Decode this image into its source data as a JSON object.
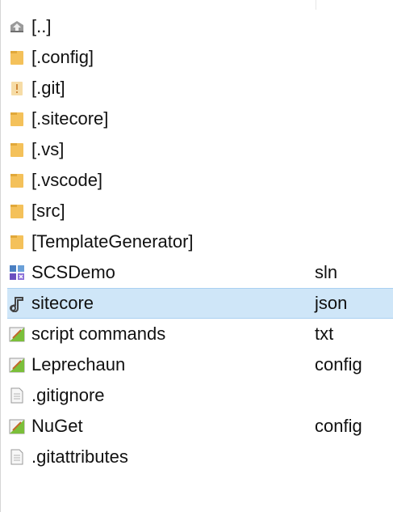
{
  "file_list": {
    "items": [
      {
        "name": "[..]",
        "ext": "",
        "icon": "up-folder-icon"
      },
      {
        "name": "[.config]",
        "ext": "",
        "icon": "folder-icon"
      },
      {
        "name": "[.git]",
        "ext": "",
        "icon": "hidden-folder-icon"
      },
      {
        "name": "[.sitecore]",
        "ext": "",
        "icon": "folder-icon"
      },
      {
        "name": "[.vs]",
        "ext": "",
        "icon": "folder-icon"
      },
      {
        "name": "[.vscode]",
        "ext": "",
        "icon": "folder-icon"
      },
      {
        "name": "[src]",
        "ext": "",
        "icon": "folder-icon"
      },
      {
        "name": "[TemplateGenerator]",
        "ext": "",
        "icon": "folder-icon"
      },
      {
        "name": "SCSDemo",
        "ext": "sln",
        "icon": "solution-file-icon"
      },
      {
        "name": "sitecore",
        "ext": "json",
        "icon": "json-file-icon",
        "selected": true
      },
      {
        "name": "script commands",
        "ext": "txt",
        "icon": "text-file-icon"
      },
      {
        "name": "Leprechaun",
        "ext": "config",
        "icon": "config-file-icon"
      },
      {
        "name": ".gitignore",
        "ext": "",
        "icon": "plain-file-icon"
      },
      {
        "name": "NuGet",
        "ext": "config",
        "icon": "config-file-icon"
      },
      {
        "name": ".gitattributes",
        "ext": "",
        "icon": "plain-file-icon"
      }
    ]
  },
  "colors": {
    "folder": "#f4c15a",
    "selection": "#cfe6f8",
    "selection_border": "#a9d0f1"
  }
}
